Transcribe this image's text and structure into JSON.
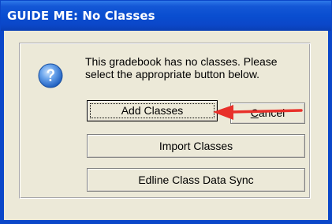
{
  "dialog": {
    "title": "GUIDE ME: No Classes",
    "message": "This gradebook has no classes. Please select the appropriate button below.",
    "icon": "help-question-icon"
  },
  "buttons": {
    "add_classes": "Add Classes",
    "cancel_accel": "C",
    "cancel_rest": "ancel",
    "import_classes": "Import Classes",
    "edline_sync": "Edline Class Data Sync"
  },
  "annotation": {
    "arrow_color": "#e8302a",
    "points_to": "add-classes-button"
  },
  "colors": {
    "titlebar": "#0a4ed0",
    "dialog_bg": "#ece9d8",
    "icon_blue": "#3a7bd5"
  }
}
